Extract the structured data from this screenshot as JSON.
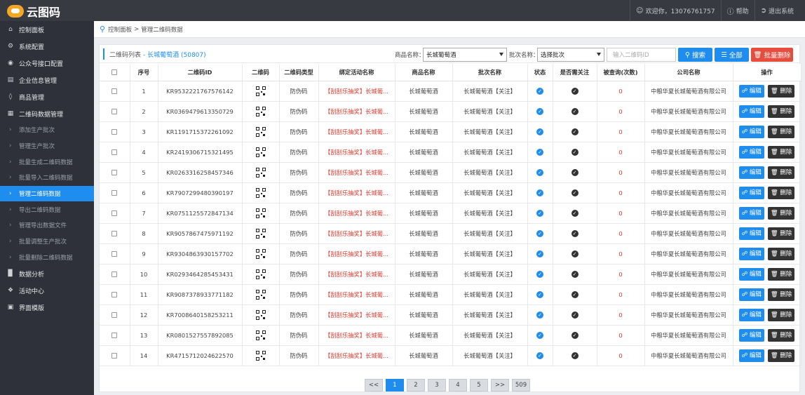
{
  "header": {
    "logo_text": "云图码",
    "welcome": "欢迎你，13076761757",
    "help": "帮助",
    "logout": "退出系统"
  },
  "sidebar": {
    "items": [
      {
        "label": "控制面板",
        "icon": "home-icon"
      },
      {
        "label": "系统配置",
        "icon": "gear-icon"
      },
      {
        "label": "公众号接口配置",
        "icon": "wechat-icon"
      },
      {
        "label": "企业信息管理",
        "icon": "id-card-icon"
      },
      {
        "label": "商品管理",
        "icon": "cubes-icon"
      },
      {
        "label": "二维码数据管理",
        "icon": "qrcode-icon"
      }
    ],
    "subitems": [
      {
        "label": "添加生产批次"
      },
      {
        "label": "管理生产批次"
      },
      {
        "label": "批量生成二维码数据"
      },
      {
        "label": "批量导入二维码数据"
      },
      {
        "label": "管理二维码数据",
        "active": true
      },
      {
        "label": "导出二维码数据"
      },
      {
        "label": "管理导出数据文件"
      },
      {
        "label": "批量调整生产批次"
      },
      {
        "label": "批量删除二维码数据"
      }
    ],
    "bottom_items": [
      {
        "label": "数据分析",
        "icon": "bar-chart-icon"
      },
      {
        "label": "活动中心",
        "icon": "dropbox-icon"
      },
      {
        "label": "界面模版",
        "icon": "database-icon"
      }
    ]
  },
  "breadcrumb": {
    "root": "控制面板",
    "sep": ">",
    "current": "管理二维码数据"
  },
  "panel": {
    "title": "二维码列表",
    "subtitle": "- 长城葡萄酒 (50807)",
    "filter_product_label": "商品名称：",
    "filter_product_value": "长城葡萄酒",
    "filter_batch_label": "批次名称：",
    "filter_batch_value": "选择批次",
    "search_placeholder": "输入二维码ID",
    "search_button": "搜索",
    "all_button": "全部",
    "batch_delete_button": "批量删除"
  },
  "table": {
    "columns": [
      "",
      "序号",
      "二维码ID",
      "二维码",
      "二维码类型",
      "绑定活动名称",
      "商品名称",
      "批次名称",
      "状态",
      "是否需关注",
      "被查询(次数)",
      "公司名称",
      "操作"
    ],
    "edit_label": "编辑",
    "delete_label": "删除",
    "rows": [
      {
        "no": "1",
        "id": "KR9532221767576142",
        "type": "防伪码",
        "activity": "【刮刮乐抽奖】长城葡...",
        "product": "长城葡萄酒",
        "batch": "长城葡萄酒【关注】",
        "queries": "0",
        "company": "中粮华夏长城葡萄酒有限公司"
      },
      {
        "no": "2",
        "id": "KR0369479613350729",
        "type": "防伪码",
        "activity": "【刮刮乐抽奖】长城葡...",
        "product": "长城葡萄酒",
        "batch": "长城葡萄酒【关注】",
        "queries": "0",
        "company": "中粮华夏长城葡萄酒有限公司"
      },
      {
        "no": "3",
        "id": "KR1191715372261092",
        "type": "防伪码",
        "activity": "【刮刮乐抽奖】长城葡...",
        "product": "长城葡萄酒",
        "batch": "长城葡萄酒【关注】",
        "queries": "0",
        "company": "中粮华夏长城葡萄酒有限公司"
      },
      {
        "no": "4",
        "id": "KR2419306715321495",
        "type": "防伪码",
        "activity": "【刮刮乐抽奖】长城葡...",
        "product": "长城葡萄酒",
        "batch": "长城葡萄酒【关注】",
        "queries": "0",
        "company": "中粮华夏长城葡萄酒有限公司"
      },
      {
        "no": "5",
        "id": "KR0263316258457346",
        "type": "防伪码",
        "activity": "【刮刮乐抽奖】长城葡...",
        "product": "长城葡萄酒",
        "batch": "长城葡萄酒【关注】",
        "queries": "0",
        "company": "中粮华夏长城葡萄酒有限公司"
      },
      {
        "no": "6",
        "id": "KR7907299480390197",
        "type": "防伪码",
        "activity": "【刮刮乐抽奖】长城葡...",
        "product": "长城葡萄酒",
        "batch": "长城葡萄酒【关注】",
        "queries": "0",
        "company": "中粮华夏长城葡萄酒有限公司"
      },
      {
        "no": "7",
        "id": "KR0751125572847134",
        "type": "防伪码",
        "activity": "【刮刮乐抽奖】长城葡...",
        "product": "长城葡萄酒",
        "batch": "长城葡萄酒【关注】",
        "queries": "0",
        "company": "中粮华夏长城葡萄酒有限公司"
      },
      {
        "no": "8",
        "id": "KR9057867475971192",
        "type": "防伪码",
        "activity": "【刮刮乐抽奖】长城葡...",
        "product": "长城葡萄酒",
        "batch": "长城葡萄酒【关注】",
        "queries": "0",
        "company": "中粮华夏长城葡萄酒有限公司"
      },
      {
        "no": "9",
        "id": "KR9304863930157702",
        "type": "防伪码",
        "activity": "【刮刮乐抽奖】长城葡...",
        "product": "长城葡萄酒",
        "batch": "长城葡萄酒【关注】",
        "queries": "0",
        "company": "中粮华夏长城葡萄酒有限公司"
      },
      {
        "no": "10",
        "id": "KR0293464285453431",
        "type": "防伪码",
        "activity": "【刮刮乐抽奖】长城葡...",
        "product": "长城葡萄酒",
        "batch": "长城葡萄酒【关注】",
        "queries": "0",
        "company": "中粮华夏长城葡萄酒有限公司"
      },
      {
        "no": "11",
        "id": "KR9087378933771182",
        "type": "防伪码",
        "activity": "【刮刮乐抽奖】长城葡...",
        "product": "长城葡萄酒",
        "batch": "长城葡萄酒【关注】",
        "queries": "0",
        "company": "中粮华夏长城葡萄酒有限公司"
      },
      {
        "no": "12",
        "id": "KR7008640158253211",
        "type": "防伪码",
        "activity": "【刮刮乐抽奖】长城葡...",
        "product": "长城葡萄酒",
        "batch": "长城葡萄酒【关注】",
        "queries": "0",
        "company": "中粮华夏长城葡萄酒有限公司"
      },
      {
        "no": "13",
        "id": "KR0801527557892085",
        "type": "防伪码",
        "activity": "【刮刮乐抽奖】长城葡...",
        "product": "长城葡萄酒",
        "batch": "长城葡萄酒【关注】",
        "queries": "0",
        "company": "中粮华夏长城葡萄酒有限公司"
      },
      {
        "no": "14",
        "id": "KR4715712024622570",
        "type": "防伪码",
        "activity": "【刮刮乐抽奖】长城葡...",
        "product": "长城葡萄酒",
        "batch": "长城葡萄酒【关注】",
        "queries": "0",
        "company": "中粮华夏长城葡萄酒有限公司"
      }
    ]
  },
  "pagination": {
    "prev": "<<",
    "pages": [
      "1",
      "2",
      "3",
      "4",
      "5"
    ],
    "current": "1",
    "next": ">>",
    "last": "509"
  },
  "colors": {
    "accent": "#1f8ded",
    "danger": "#e84c3d",
    "sidebar_bg": "#2e3139",
    "topbar_bg": "#373a41"
  }
}
